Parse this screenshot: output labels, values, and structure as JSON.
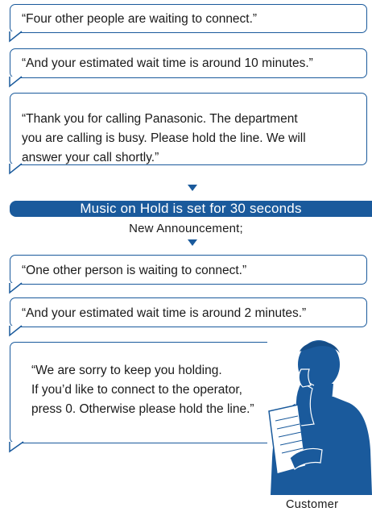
{
  "colors": {
    "accent": "#1a5a9c",
    "text": "#1a1a1a"
  },
  "announcements_before": [
    {
      "text": "“Four other people are waiting to connect.”"
    },
    {
      "text": "“And your estimated wait time is around 10 minutes.”"
    },
    {
      "lines": [
        "“Thank you for calling Panasonic. The department",
        "you are calling is busy. Please hold the line. We will",
        "answer your call shortly.”"
      ]
    }
  ],
  "music_on_hold": "Music on Hold is set for 30 seconds",
  "new_announcement": "New Announcement;",
  "announcements_after": [
    {
      "text": "“One other person is waiting to connect.”"
    },
    {
      "text": "“And your estimated wait time is around 2 minutes.”"
    },
    {
      "lines": [
        "“We are sorry to keep you holding.",
        "If you’d like to connect to the operator,",
        "press 0. Otherwise please hold the line.”"
      ]
    }
  ],
  "customer_label": "Customer",
  "customer_icon": "person-on-phone-icon"
}
